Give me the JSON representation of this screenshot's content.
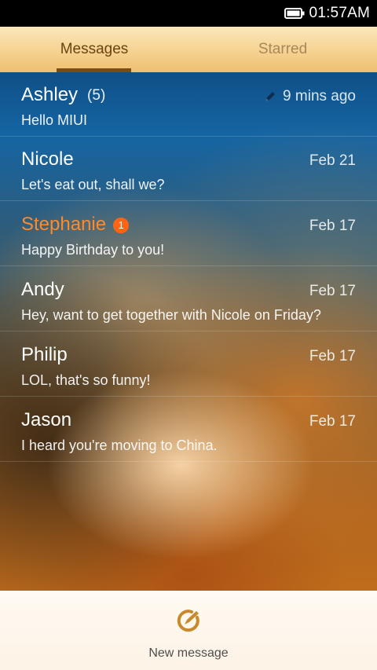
{
  "status_bar": {
    "time": "01:57AM",
    "battery_icon": "battery-icon"
  },
  "tabs": [
    {
      "label": "Messages",
      "active": true
    },
    {
      "label": "Starred",
      "active": false
    }
  ],
  "conversations": [
    {
      "name": "Ashley",
      "count": "(5)",
      "date": "9 mins ago",
      "draft_icon": "pencil-icon",
      "preview": "Hello MIUI"
    },
    {
      "name": "Nicole",
      "date": "Feb 21",
      "preview": "Let's eat out, shall we?"
    },
    {
      "name": "Stephanie",
      "unread_badge": "1",
      "date": "Feb 17",
      "preview": "Happy Birthday to you!"
    },
    {
      "name": "Andy",
      "date": "Feb 17",
      "preview": "Hey, want to get together with Nicole on Friday?"
    },
    {
      "name": "Philip",
      "date": "Feb 17",
      "preview": "LOL, that's so funny!"
    },
    {
      "name": "Jason",
      "date": "Feb 17",
      "preview": "I heard you're moving to China."
    }
  ],
  "bottom_bar": {
    "new_message_label": "New message",
    "icon": "compose-icon"
  },
  "colors": {
    "accent": "#7a4e12",
    "unread": "#ff8a2a",
    "badge": "#ff6314",
    "compose_icon": "#c98a2e"
  }
}
